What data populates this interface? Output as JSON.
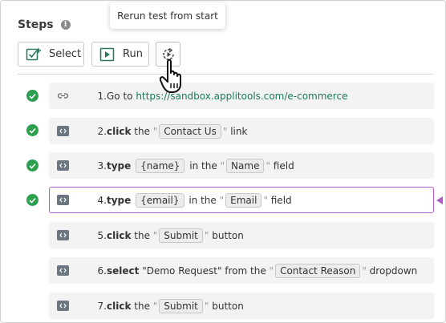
{
  "header": {
    "title": "Steps",
    "info_icon": "info-icon"
  },
  "tooltip": {
    "text": "Rerun test from start"
  },
  "toolbar": {
    "select_label": "Select",
    "run_label": "Run",
    "rerun_icon": "rerun-icon"
  },
  "colors": {
    "accent_active": "#b05cc8",
    "check_green": "#2e9e4f",
    "link_green": "#1a7a5a"
  },
  "steps": [
    {
      "num": "1.",
      "status": "passed",
      "icon": "link-icon",
      "pre": "Go to ",
      "url": "https://sandbox.applitools.com/e-commerce"
    },
    {
      "num": "2.",
      "status": "passed",
      "icon": "code-icon",
      "kw": "click",
      "mid1": " the ",
      "chip": "Contact Us",
      "post": " link"
    },
    {
      "num": "3.",
      "status": "passed",
      "icon": "code-icon",
      "kw": "type",
      "var": "{name}",
      "mid1": " in the ",
      "chip": "Name",
      "post": " field"
    },
    {
      "num": "4.",
      "status": "passed",
      "icon": "code-icon",
      "kw": "type",
      "var": "{email}",
      "mid1": " in the ",
      "chip": "Email",
      "post": " field"
    },
    {
      "num": "5.",
      "status": "pending",
      "icon": "code-icon",
      "kw": "click",
      "mid1": " the ",
      "chip": "Submit",
      "post": " button"
    },
    {
      "num": "6.",
      "status": "pending",
      "icon": "code-icon",
      "kw": "select",
      "mid1": " \"Demo Request\" from the ",
      "chip": "Contact Reason",
      "post": " dropdown"
    },
    {
      "num": "7.",
      "status": "pending",
      "icon": "code-icon",
      "kw": "click",
      "mid1": " the ",
      "chip": "Submit",
      "post": " button"
    }
  ]
}
